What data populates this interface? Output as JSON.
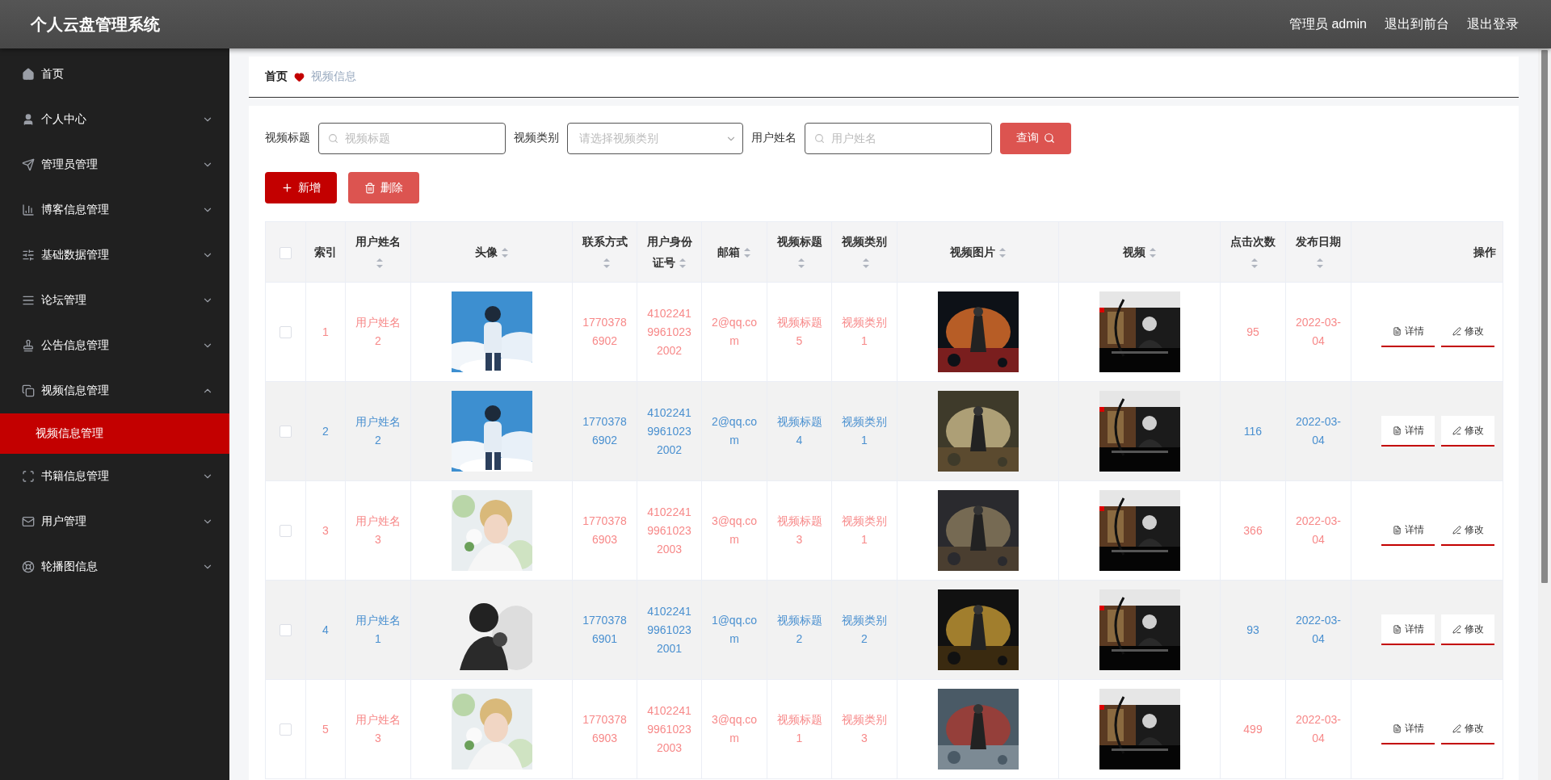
{
  "header": {
    "title": "个人云盘管理系统",
    "links": [
      "管理员 admin",
      "退出到前台",
      "退出登录"
    ]
  },
  "sidebar": {
    "items": [
      {
        "label": "首页"
      },
      {
        "label": "个人中心",
        "expanded": false
      },
      {
        "label": "管理员管理",
        "expanded": false
      },
      {
        "label": "博客信息管理",
        "expanded": false
      },
      {
        "label": "基础数据管理",
        "expanded": false
      },
      {
        "label": "论坛管理",
        "expanded": false
      },
      {
        "label": "公告信息管理",
        "expanded": false
      },
      {
        "label": "视频信息管理",
        "expanded": true,
        "children": [
          {
            "label": "视频信息管理",
            "selected": true
          }
        ]
      },
      {
        "label": "书籍信息管理",
        "expanded": false
      },
      {
        "label": "用户管理",
        "expanded": false
      },
      {
        "label": "轮播图信息",
        "expanded": false
      }
    ]
  },
  "breadcrumb": [
    "首页",
    "视频信息"
  ],
  "search": {
    "fields": [
      {
        "kind": "text",
        "label": "视频标题",
        "placeholder": "视频标题"
      },
      {
        "kind": "select",
        "label": "视频类别",
        "placeholder": "请选择视频类别"
      },
      {
        "kind": "text",
        "label": "用户姓名",
        "placeholder": "用户姓名"
      }
    ],
    "button": "查询"
  },
  "actions": [
    {
      "kind": "add",
      "label": "新增"
    },
    {
      "kind": "delete",
      "label": "删除"
    }
  ],
  "table": {
    "striped": true,
    "all_checked": false,
    "columns": [
      {
        "label": "索引",
        "sortable": false
      },
      {
        "label": "用户姓名",
        "sortable": true
      },
      {
        "label": "头像",
        "sortable": true
      },
      {
        "label": "联系方式",
        "sortable": true
      },
      {
        "label": "用户身份证号",
        "sortable": true
      },
      {
        "label": "邮箱",
        "sortable": true
      },
      {
        "label": "视频标题",
        "sortable": true
      },
      {
        "label": "视频类别",
        "sortable": true
      },
      {
        "label": "视频图片",
        "sortable": true
      },
      {
        "label": "视频",
        "sortable": true
      },
      {
        "label": "点击次数",
        "sortable": true
      },
      {
        "label": "发布日期",
        "sortable": true
      },
      {
        "label": "操作",
        "sortable": false
      }
    ],
    "rows": [
      {
        "checked": false,
        "color": "#f78989",
        "index": "1",
        "name": "用户姓名2",
        "phone": "17703786902",
        "id_card": "410224199610232002",
        "email": "2@qq.com",
        "title": "视频标题5",
        "category": "视频类别1",
        "clicks": "95",
        "date": "2022-03-04",
        "buttons": [
          "详情",
          "修改"
        ]
      },
      {
        "checked": false,
        "color": "#4a90d0",
        "index": "2",
        "name": "用户姓名2",
        "phone": "17703786902",
        "id_card": "410224199610232002",
        "email": "2@qq.com",
        "title": "视频标题4",
        "category": "视频类别1",
        "clicks": "116",
        "date": "2022-03-04",
        "buttons": [
          "详情",
          "修改"
        ]
      },
      {
        "checked": false,
        "color": "#f78989",
        "index": "3",
        "name": "用户姓名3",
        "phone": "17703786903",
        "id_card": "410224199610232003",
        "email": "3@qq.com",
        "title": "视频标题3",
        "category": "视频类别1",
        "clicks": "366",
        "date": "2022-03-04",
        "buttons": [
          "详情",
          "修改"
        ]
      },
      {
        "checked": false,
        "color": "#4a90d0",
        "index": "4",
        "name": "用户姓名1",
        "phone": "17703786901",
        "id_card": "410224199610232001",
        "email": "1@qq.com",
        "title": "视频标题2",
        "category": "视频类别2",
        "clicks": "93",
        "date": "2022-03-04",
        "buttons": [
          "详情",
          "修改"
        ]
      },
      {
        "checked": false,
        "color": "#f78989",
        "index": "5",
        "name": "用户姓名3",
        "phone": "17703786903",
        "id_card": "410224199610232003",
        "email": "3@qq.com",
        "title": "视频标题1",
        "category": "视频类别3",
        "clicks": "499",
        "date": "2022-03-04",
        "buttons": [
          "详情",
          "修改"
        ]
      }
    ]
  }
}
